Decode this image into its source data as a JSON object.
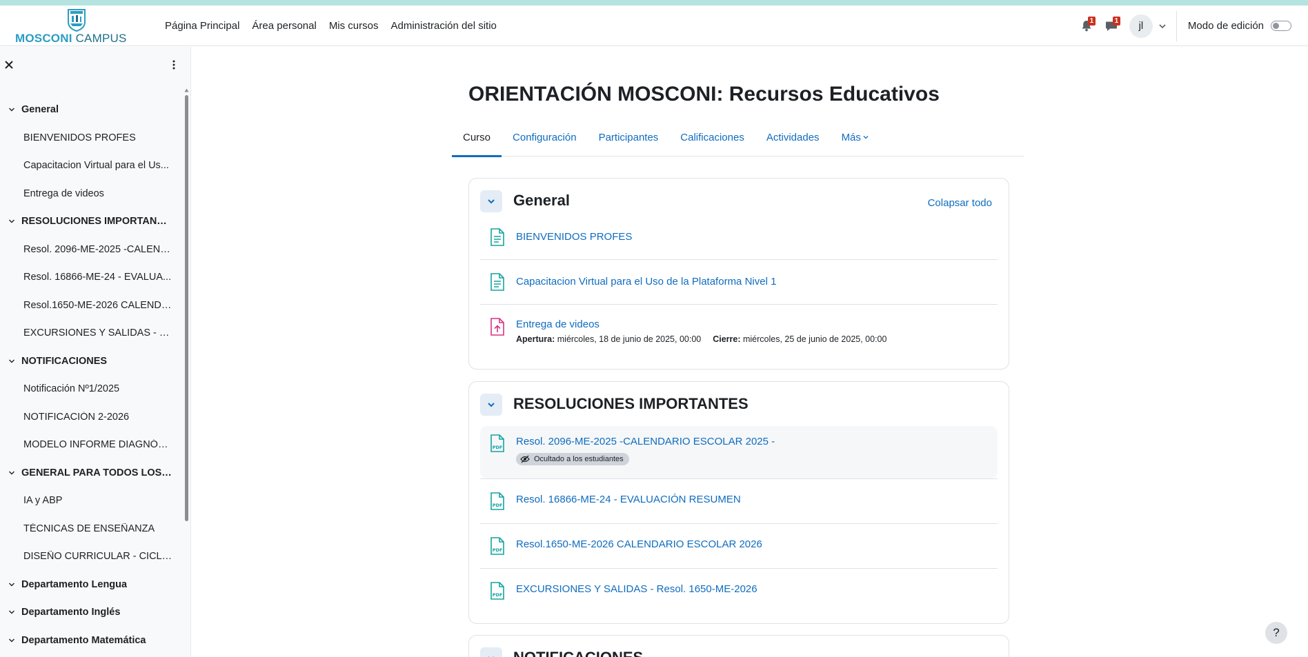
{
  "brand": {
    "name_strong": "MOSCONI",
    "name_light": "CAMPUS"
  },
  "nav": {
    "items": [
      {
        "label": "Página Principal"
      },
      {
        "label": "Área personal"
      },
      {
        "label": "Mis cursos"
      },
      {
        "label": "Administración del sitio"
      }
    ],
    "notifications_count": "1",
    "messages_count": "1",
    "user_initials": "jl",
    "edit_mode_label": "Modo de edición",
    "edit_mode_on": false
  },
  "drawer": {
    "items": [
      {
        "type": "section",
        "label": "General"
      },
      {
        "type": "activity",
        "label": "BIENVENIDOS PROFES"
      },
      {
        "type": "activity",
        "label": "Capacitacion Virtual para el Us..."
      },
      {
        "type": "activity",
        "label": "Entrega de videos"
      },
      {
        "type": "section",
        "label": "RESOLUCIONES IMPORTANTES"
      },
      {
        "type": "activity",
        "label": "Resol. 2096-ME-2025 -CALEND..."
      },
      {
        "type": "activity",
        "label": "Resol. 16866-ME-24 - EVALUA..."
      },
      {
        "type": "activity",
        "label": "Resol.1650-ME-2026 CALENDA..."
      },
      {
        "type": "activity",
        "label": "EXCURSIONES Y SALIDAS - Res..."
      },
      {
        "type": "section",
        "label": "NOTIFICACIONES"
      },
      {
        "type": "activity",
        "label": "Notificación Nº1/2025"
      },
      {
        "type": "activity",
        "label": "NOTIFICACIÓN 2-2026"
      },
      {
        "type": "activity",
        "label": "MODELO INFORME DIAGNÓST..."
      },
      {
        "type": "section",
        "label": "GENERAL PARA TODOS LOS ..."
      },
      {
        "type": "activity",
        "label": "IA y ABP"
      },
      {
        "type": "activity",
        "label": "TÉCNICAS DE ENSEÑANZA"
      },
      {
        "type": "activity",
        "label": "DISEÑO CURRICULAR - CICLO ..."
      },
      {
        "type": "section",
        "label": "Departamento Lengua"
      },
      {
        "type": "section",
        "label": "Departamento Inglés"
      },
      {
        "type": "section",
        "label": "Departamento Matemática"
      }
    ]
  },
  "course": {
    "title": "ORIENTACIÓN MOSCONI: Recursos Educativos",
    "tabs": [
      {
        "label": "Curso",
        "active": true
      },
      {
        "label": "Configuración"
      },
      {
        "label": "Participantes"
      },
      {
        "label": "Calificaciones"
      },
      {
        "label": "Actividades"
      },
      {
        "label": "Más"
      }
    ],
    "collapse_all": "Colapsar todo"
  },
  "sections": {
    "general": {
      "title": "General",
      "activities": [
        {
          "name": "BIENVENIDOS PROFES",
          "icon": "page-icon"
        },
        {
          "name": "Capacitacion Virtual para el Uso de la Plataforma Nivel 1",
          "icon": "page-icon"
        },
        {
          "name": "Entrega de videos",
          "icon": "assignment-upload-icon",
          "open_label": "Apertura:",
          "open_value": "miércoles, 18 de junio de 2025, 00:00",
          "close_label": "Cierre:",
          "close_value": "miércoles, 25 de junio de 2025, 00:00"
        }
      ]
    },
    "resoluciones": {
      "title": "RESOLUCIONES IMPORTANTES",
      "activities": [
        {
          "name": "Resol. 2096-ME-2025 -CALENDARIO ESCOLAR 2025 -",
          "icon": "pdf-icon",
          "badge": "Ocultado a los estudiantes"
        },
        {
          "name": "Resol. 16866-ME-24 - EVALUACIÓN RESUMEN",
          "icon": "pdf-icon"
        },
        {
          "name": "Resol.1650-ME-2026 CALENDARIO ESCOLAR 2026",
          "icon": "pdf-icon"
        },
        {
          "name": "EXCURSIONES Y SALIDAS - Resol. 1650-ME-2026",
          "icon": "pdf-icon"
        }
      ]
    },
    "notificaciones": {
      "title": "NOTIFICACIONES"
    }
  },
  "help": {
    "label": "?"
  },
  "colors": {
    "link": "#0f6cbf",
    "accent_teal": "#14a3a0",
    "assignment_pink": "#d63384",
    "badge_red": "#ca3120",
    "top_strip": "#b5e3e0"
  }
}
